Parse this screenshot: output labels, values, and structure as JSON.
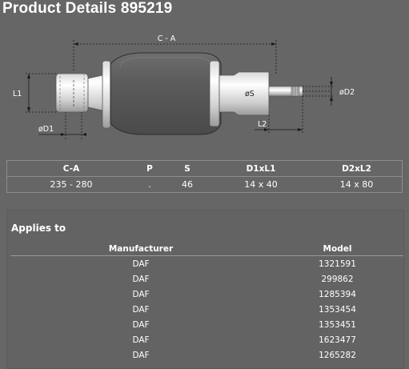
{
  "title": "Product Details 895219",
  "drawing": {
    "label_ca": "C - A",
    "label_l1": "L1",
    "label_d1": "øD1",
    "label_s": "øS",
    "label_d2": "øD2",
    "label_l2": "L2"
  },
  "specs": {
    "headers": [
      "C-A",
      "P",
      "S",
      "D1xL1",
      "D2xL2"
    ],
    "row": [
      "235 - 280",
      ".",
      "46",
      "14 x 40",
      "14 x 80"
    ]
  },
  "applies": {
    "title": "Applies to",
    "headers": [
      "Manufacturer",
      "Model"
    ],
    "rows": [
      [
        "DAF",
        "1321591"
      ],
      [
        "DAF",
        "299862"
      ],
      [
        "DAF",
        "1285394"
      ],
      [
        "DAF",
        "1353454"
      ],
      [
        "DAF",
        "1353451"
      ],
      [
        "DAF",
        "1623477"
      ],
      [
        "DAF",
        "1265282"
      ]
    ]
  }
}
